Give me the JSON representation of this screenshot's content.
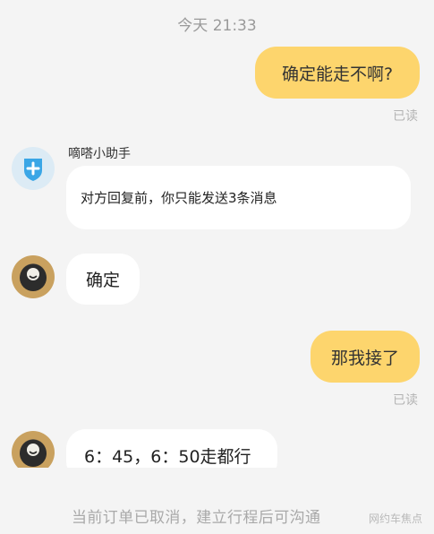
{
  "chat": {
    "timestamp": "今天 21:33",
    "read_label": "已读",
    "messages": [
      {
        "from": "me",
        "text": "确定能走不啊?"
      },
      {
        "from": "assistant",
        "sender": "嘀嗒小助手",
        "text": "对方回复前，你只能发送3条消息"
      },
      {
        "from": "other",
        "text": "确定"
      },
      {
        "from": "me",
        "text": "那我接了"
      },
      {
        "from": "other",
        "text": "6：45，6：50走都行"
      }
    ]
  },
  "footer": {
    "notice": "当前订单已取消，建立行程后可沟通",
    "watermark": "网约车焦点"
  },
  "colors": {
    "outgoing_bubble": "#fdd56d",
    "incoming_bubble": "#ffffff",
    "background": "#f4f4f4"
  },
  "icons": [
    "assistant-shield-icon",
    "user-avatar-image"
  ]
}
